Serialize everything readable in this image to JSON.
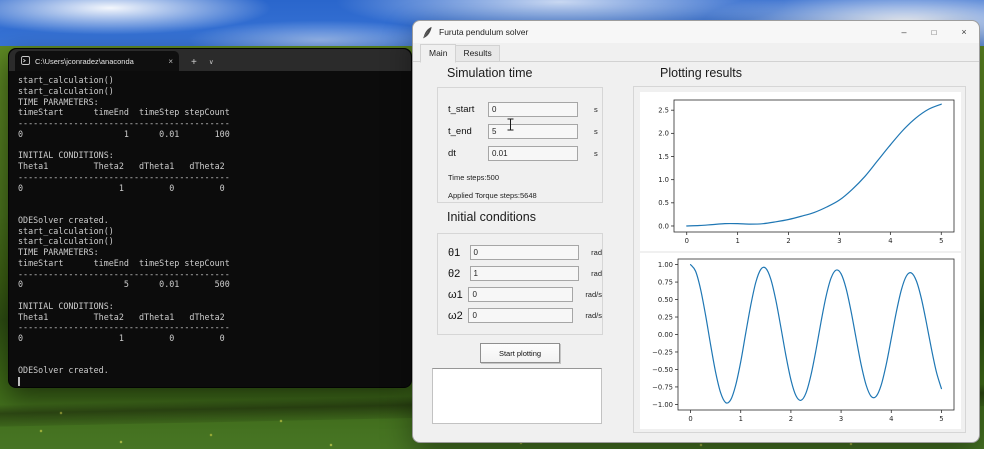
{
  "terminal": {
    "tab_title": "C:\\Users\\jconradez\\anaconda",
    "close_glyph": "×",
    "new_tab_glyph": "+",
    "dropdown_glyph": "∨",
    "lines": [
      "start_calculation()",
      "start_calculation()",
      "TIME PARAMETERS:",
      "timeStart      timeEnd  timeStep stepCount",
      "------------------------------------------",
      "0                    1      0.01       100",
      "",
      "INITIAL CONDITIONS:",
      "Theta1         Theta2   dTheta1   dTheta2",
      "------------------------------------------",
      "0                   1         0         0",
      "",
      "",
      "ODESolver created.",
      "start_calculation()",
      "start_calculation()",
      "TIME PARAMETERS:",
      "timeStart      timeEnd  timeStep stepCount",
      "------------------------------------------",
      "0                    5      0.01       500",
      "",
      "INITIAL CONDITIONS:",
      "Theta1         Theta2   dTheta1   dTheta2",
      "------------------------------------------",
      "0                   1         0         0",
      "",
      "",
      "ODESolver created."
    ]
  },
  "app": {
    "title": "Furuta pendulum solver",
    "controls": {
      "minimize": "–",
      "maximize": "□",
      "close": "×"
    },
    "tabs": [
      {
        "id": "main",
        "label": "Main",
        "active": true
      },
      {
        "id": "results",
        "label": "Results",
        "active": false
      }
    ],
    "simulation_time": {
      "heading": "Simulation time",
      "fields": [
        {
          "id": "t_start",
          "label": "t_start",
          "value": "0",
          "unit": "s"
        },
        {
          "id": "t_end",
          "label": "t_end",
          "value": "5",
          "unit": "s"
        },
        {
          "id": "dt",
          "label": "dt",
          "value": "0.01",
          "unit": "s"
        }
      ],
      "info": [
        "Time steps:500",
        "Applied Torque steps:5648"
      ]
    },
    "initial_conditions": {
      "heading": "Initial conditions",
      "fields": [
        {
          "id": "theta1",
          "label": "θ1",
          "value": "0",
          "unit": "rad"
        },
        {
          "id": "theta2",
          "label": "θ2",
          "value": "1",
          "unit": "rad"
        },
        {
          "id": "omega1",
          "label": "ω1",
          "value": "0",
          "unit": "rad/s"
        },
        {
          "id": "omega2",
          "label": "ω2",
          "value": "0",
          "unit": "rad/s"
        }
      ]
    },
    "plotting": {
      "heading": "Plotting results",
      "button_label": "Start plotting"
    }
  },
  "chart_data": [
    {
      "type": "line",
      "name": "theta1-vs-time",
      "title": "",
      "xlabel": "",
      "ylabel": "",
      "line_color": "#1f77b4",
      "xlim": [
        -0.25,
        5.25
      ],
      "ylim": [
        -0.13,
        2.72
      ],
      "xticks": {
        "values": [
          0,
          1,
          2,
          3,
          4,
          5
        ],
        "labels": [
          "0",
          "1",
          "2",
          "3",
          "4",
          "5"
        ]
      },
      "yticks": {
        "values": [
          0,
          0.5,
          1.0,
          1.5,
          2.0,
          2.5
        ],
        "labels": [
          "0.0",
          "0.5",
          "1.0",
          "1.5",
          "2.0",
          "2.5"
        ]
      },
      "x": [
        0,
        0.25,
        0.5,
        0.75,
        1,
        1.25,
        1.5,
        1.75,
        2,
        2.25,
        2.5,
        2.75,
        3,
        3.25,
        3.5,
        3.75,
        4,
        4.25,
        4.5,
        4.75,
        5
      ],
      "y": [
        0,
        0.01,
        0.03,
        0.05,
        0.05,
        0.04,
        0.05,
        0.09,
        0.14,
        0.21,
        0.29,
        0.41,
        0.56,
        0.79,
        1.07,
        1.41,
        1.75,
        2.07,
        2.33,
        2.52,
        2.63
      ]
    },
    {
      "type": "line",
      "name": "theta2-vs-time",
      "title": "",
      "xlabel": "",
      "ylabel": "",
      "line_color": "#1f77b4",
      "xlim": [
        -0.25,
        5.25
      ],
      "ylim": [
        -1.08,
        1.08
      ],
      "xticks": {
        "values": [
          0,
          1,
          2,
          3,
          4,
          5
        ],
        "labels": [
          "0",
          "1",
          "2",
          "3",
          "4",
          "5"
        ]
      },
      "yticks": {
        "values": [
          -1,
          -0.75,
          -0.5,
          -0.25,
          0,
          0.25,
          0.5,
          0.75,
          1
        ],
        "labels": [
          "−1.00",
          "−0.75",
          "−0.50",
          "−0.25",
          "0.00",
          "0.25",
          "0.50",
          "0.75",
          "1.00"
        ]
      },
      "x": [
        0,
        0.1,
        0.2,
        0.3,
        0.4,
        0.5,
        0.6,
        0.7,
        0.8,
        0.9,
        1,
        1.1,
        1.2,
        1.3,
        1.4,
        1.5,
        1.6,
        1.7,
        1.8,
        1.9,
        2,
        2.1,
        2.2,
        2.3,
        2.4,
        2.5,
        2.6,
        2.7,
        2.8,
        2.9,
        3,
        3.1,
        3.2,
        3.3,
        3.4,
        3.5,
        3.6,
        3.7,
        3.8,
        3.9,
        4,
        4.1,
        4.2,
        4.3,
        4.4,
        4.5,
        4.6,
        4.7,
        4.8,
        4.9,
        5
      ],
      "y": [
        1.0,
        0.906,
        0.648,
        0.275,
        -0.148,
        -0.541,
        -0.835,
        -0.974,
        -0.935,
        -0.724,
        -0.39,
        0.021,
        0.419,
        0.746,
        0.932,
        0.947,
        0.79,
        0.49,
        0.103,
        -0.3,
        -0.648,
        -0.875,
        -0.942,
        -0.838,
        -0.579,
        -0.221,
        0.18,
        0.544,
        0.807,
        0.921,
        0.868,
        0.657,
        0.327,
        -0.058,
        -0.433,
        -0.726,
        -0.886,
        -0.883,
        -0.721,
        -0.428,
        -0.058,
        0.319,
        0.636,
        0.835,
        0.881,
        0.767,
        0.514,
        0.169,
        -0.204,
        -0.538,
        -0.774
      ]
    }
  ]
}
